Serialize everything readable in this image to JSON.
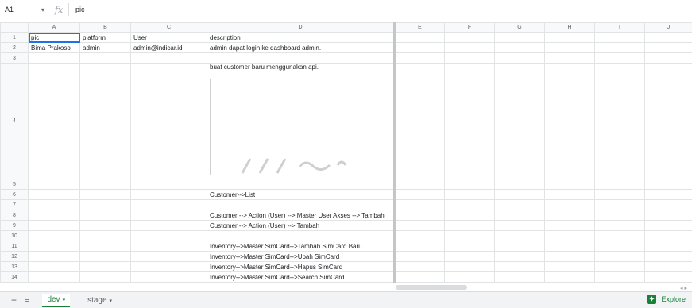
{
  "formula_bar": {
    "cell_ref": "A1",
    "fx_symbol": "fx",
    "content": "pic"
  },
  "columns": [
    "A",
    "B",
    "C",
    "D",
    "E",
    "F",
    "G",
    "H",
    "I",
    "J"
  ],
  "rows": [
    {
      "n": "1",
      "a": "pic",
      "b": "platform",
      "c": "User",
      "d": "description"
    },
    {
      "n": "2",
      "a": "Bima Prakoso",
      "b": "admin",
      "c": "admin@indicar.id",
      "d": "admin dapat login ke dashboard admin."
    },
    {
      "n": "3",
      "a": "",
      "b": "",
      "c": "",
      "d": ""
    },
    {
      "n": "4",
      "a": "",
      "b": "",
      "c": "",
      "d": "buat customer baru menggunakan api."
    },
    {
      "n": "5",
      "a": "",
      "b": "",
      "c": "",
      "d": ""
    },
    {
      "n": "6",
      "a": "",
      "b": "",
      "c": "",
      "d": "Customer-->List"
    },
    {
      "n": "7",
      "a": "",
      "b": "",
      "c": "",
      "d": ""
    },
    {
      "n": "8",
      "a": "",
      "b": "",
      "c": "",
      "d": "Customer --> Action (User) --> Master User Akses --> Tambah"
    },
    {
      "n": "9",
      "a": "",
      "b": "",
      "c": "",
      "d": "Customer --> Action (User) --> Tambah"
    },
    {
      "n": "10",
      "a": "",
      "b": "",
      "c": "",
      "d": ""
    },
    {
      "n": "11",
      "a": "",
      "b": "",
      "c": "",
      "d": "Inventory-->Master SimCard-->Tambah SimCard Baru"
    },
    {
      "n": "12",
      "a": "",
      "b": "",
      "c": "",
      "d": "Inventory-->Master SimCard-->Ubah SimCard"
    },
    {
      "n": "13",
      "a": "",
      "b": "",
      "c": "",
      "d": "Inventory-->Master SimCard-->Hapus SimCard"
    },
    {
      "n": "14",
      "a": "",
      "b": "",
      "c": "",
      "d": "Inventory-->Master SimCard-->Search SimCard"
    }
  ],
  "sheet_tabs": [
    {
      "label": "dev",
      "active": true
    },
    {
      "label": "stage",
      "active": false
    }
  ],
  "explore_label": "Explore",
  "icons": {
    "add_sheet": "plus-icon",
    "all_sheets": "list-icon",
    "explore": "explore-icon"
  }
}
